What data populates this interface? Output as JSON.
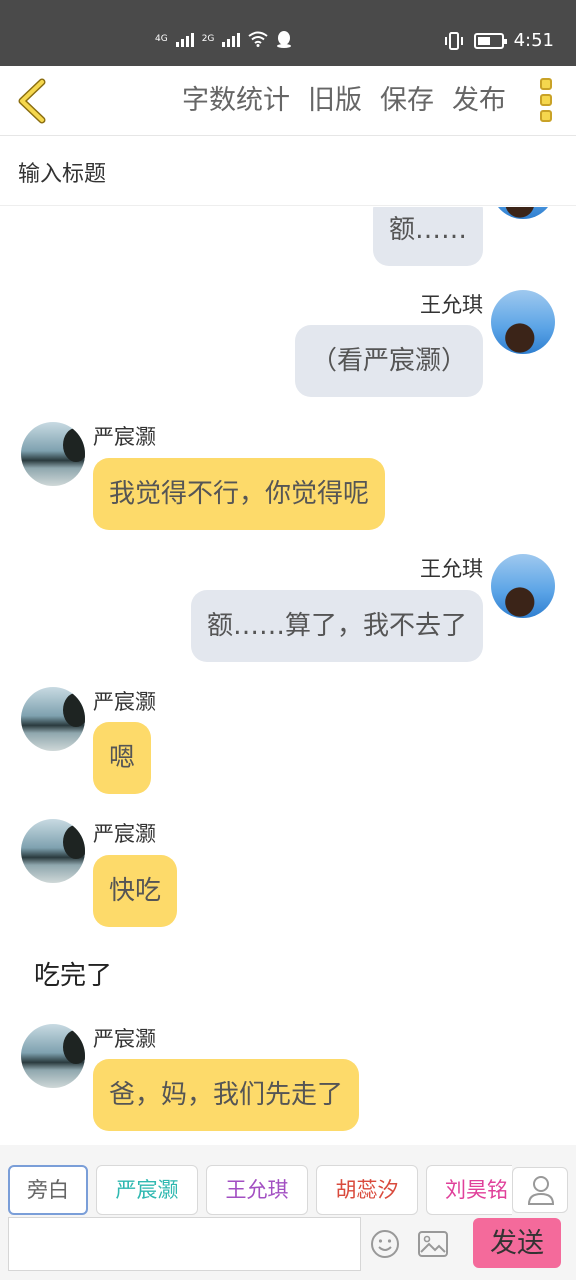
{
  "status_bar": {
    "net1": "4G",
    "net2": "2G",
    "time": "4:51",
    "battery_level": 0.55
  },
  "toolbar": {
    "word_count": "字数统计",
    "old_version": "旧版",
    "save": "保存",
    "publish": "发布"
  },
  "title": {
    "placeholder": "输入标题"
  },
  "chat": {
    "m0": {
      "text": "额……"
    },
    "m1": {
      "sender": "王允琪",
      "text": "（看严宸灏）"
    },
    "m2": {
      "sender": "严宸灏",
      "text": "我觉得不行，你觉得呢"
    },
    "m3": {
      "sender": "王允琪",
      "text": "额……算了，我不去了"
    },
    "m4": {
      "sender": "严宸灏",
      "text": "嗯"
    },
    "m5": {
      "sender": "严宸灏",
      "text": "快吃"
    },
    "narration": "吃完了",
    "m6": {
      "sender": "严宸灏",
      "text": "爸，妈，我们先走了"
    }
  },
  "characters": [
    {
      "label": "旁白",
      "color": "#666666"
    },
    {
      "label": "严宸灏",
      "color": "#2fb8b0"
    },
    {
      "label": "王允琪",
      "color": "#a24fc2"
    },
    {
      "label": "胡蕊汐",
      "color": "#d94a3c"
    },
    {
      "label": "刘昊铭",
      "color": "#e0409a"
    }
  ],
  "input": {
    "value": "",
    "send": "发送"
  },
  "colors": {
    "bubble_right": "#e3e7ee",
    "bubble_left": "#fdda6a",
    "send_button": "#f46a9b",
    "accent": "#f5d74e"
  }
}
